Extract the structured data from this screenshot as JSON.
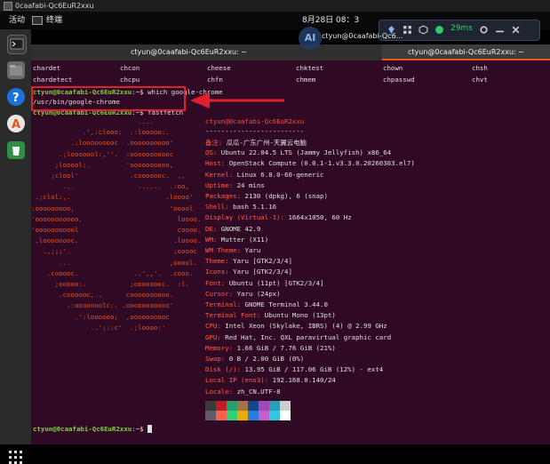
{
  "window": {
    "title": "0caafabi-Qc6EuR2xxu"
  },
  "top_bar": {
    "activities": "活动",
    "app_label": "终端",
    "clock": "8月28日 08：3"
  },
  "ai_badge": "AI",
  "toolbar": {
    "latency": "29ms"
  },
  "terminal_tabs": [
    {
      "label": "ctyun@0caafabi-Qc6EuR2xxu: ~"
    },
    {
      "label": "ctyun@0caafabi-Qc6EuR2xxu: ~"
    }
  ],
  "overlay_title": "ctyun@0caafabi-Qc6...",
  "ls_columns": [
    [
      "chardet",
      "chcon",
      "cheese",
      "chktest",
      "chown",
      "chsh"
    ],
    [
      "chardetect",
      "chcpu",
      "chfn",
      "chmem",
      "chpasswd",
      "chvt"
    ]
  ],
  "commands": {
    "prompt": "ctyun@0caafabi-Qc6EuR2xxu",
    "cmd1": ":~$ which google-chrome",
    "output1": "/usr/bin/google-chrome",
    "cmd2": ":~$ fastfetch",
    "final_prompt_suffix": ":~$ "
  },
  "ascii_logo": [
    "                           ....",
    "             .',:clooo:  .:looooo:.",
    "          .;looooooooc  .oooooooooo'",
    "       .;looooool:,''.  :ooooooooooc",
    "      ;looool;.         'oooooooooo,",
    "     ;clool'             .cooooooc.  ,,",
    "        ...                ......  .:oo,",
    " .;clol:,.                        .loooo'",
    ":ooooooooo,                        'ooool",
    "'ooooooooooo.                        loooo.",
    "'ooooooooool                         coooo.",
    " ,loooooooc.                        .loooo.",
    "   .,;;;'.                          ;ooooc",
    "       ...                         ,ooool.",
    "    .cooooc.              ..',,'.  .cooo.",
    "      ;ooooo:.           ;oooooooc.  :l.",
    "       .coooooc,..      coooooooooo.",
    "         .:ooooooolc:. .ooooooooooo'",
    "           .':loooooo;  ,oooooooooc",
    "               ..';::c'  .;loooo:'"
  ],
  "sysinfo": {
    "user_host": "ctyun@0caafabi-Qc6EuR2xxu",
    "separator": "-------------------------",
    "lines": [
      {
        "key": "备注:",
        "value": " 瓜瓜-广东广州-天翼云电脑"
      },
      {
        "key": "OS:",
        "value": " Ubuntu 22.04.5 LTS (Jammy Jellyfish) x86_64"
      },
      {
        "key": "Host:",
        "value": " OpenStack Compute (0.0.1-1.v3.3.0.20260303.el7)"
      },
      {
        "key": "Kernel:",
        "value": " Linux 6.8.0-60-generic"
      },
      {
        "key": "Uptime:",
        "value": " 24 mins"
      },
      {
        "key": "Packages:",
        "value": " 2130 (dpkg), 6 (snap)"
      },
      {
        "key": "Shell:",
        "value": " bash 5.1.16"
      },
      {
        "key": "Display (Virtual-1):",
        "value": " 1664x1050, 60 Hz"
      },
      {
        "key": "DE:",
        "value": " GNOME 42.9"
      },
      {
        "key": "WM:",
        "value": " Mutter (X11)"
      },
      {
        "key": "WM Theme:",
        "value": " Yaru"
      },
      {
        "key": "Theme:",
        "value": " Yaru [GTK2/3/4]"
      },
      {
        "key": "Icons:",
        "value": " Yaru [GTK2/3/4]"
      },
      {
        "key": "Font:",
        "value": " Ubuntu (11pt) [GTK2/3/4]"
      },
      {
        "key": "Cursor:",
        "value": " Yaru (24px)"
      },
      {
        "key": "Terminal:",
        "value": " GNOME Terminal 3.44.0"
      },
      {
        "key": "Terminal Font:",
        "value": " Ubuntu Mono (13pt)"
      },
      {
        "key": "CPU:",
        "value": " Intel Xeon (Skylake, IBRS) (4) @ 2.99 GHz"
      },
      {
        "key": "GPU:",
        "value": " Red Hat, Inc. QXL paravirtual graphic card"
      },
      {
        "key": "Memory:",
        "value": " 1.66 GiB / 7.76 GiB (21%)"
      },
      {
        "key": "Swap:",
        "value": " 0 B / 2.00 GiB (0%)"
      },
      {
        "key": "Disk (/):",
        "value": " 13.95 GiB / 117.06 GiB (12%) - ext4"
      },
      {
        "key": "Local IP (ens3):",
        "value": " 192.168.0.140/24"
      },
      {
        "key": "Locale:",
        "value": " zh_CN.UTF-8"
      }
    ]
  },
  "palette_row1": [
    "#3a3a3a",
    "#c01c28",
    "#26a269",
    "#a2734c",
    "#12488b",
    "#a347ba",
    "#2aa1b3",
    "#d0cfcc"
  ],
  "palette_row2": [
    "#5e5c64",
    "#f66151",
    "#33d17a",
    "#e9ad0c",
    "#2a7bde",
    "#c061cb",
    "#33c7de",
    "#ffffff"
  ],
  "dock_apps": [
    {
      "name": "terminal-app-icon",
      "color": "#333333"
    },
    {
      "name": "files-app-icon",
      "color": "#6b6b6b"
    },
    {
      "name": "help-app-icon",
      "color": "#1c71d8"
    },
    {
      "name": "software-app-icon",
      "color": "#e8e8e8"
    },
    {
      "name": "trash-app-icon",
      "color": "#2f8f46"
    }
  ]
}
